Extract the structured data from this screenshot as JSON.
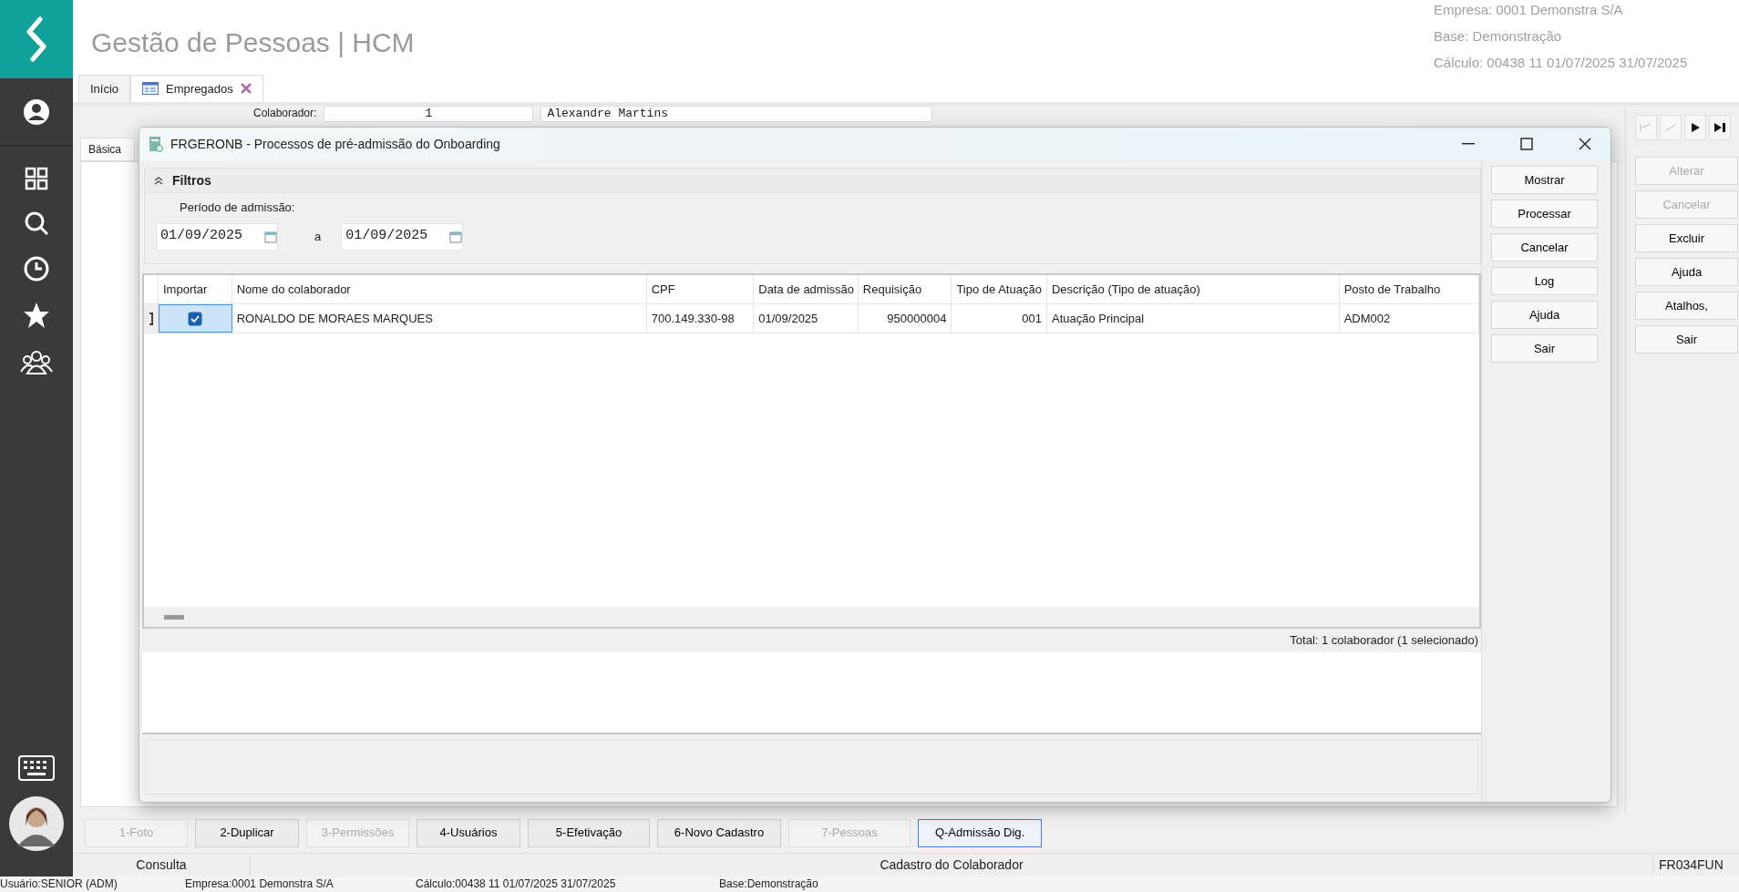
{
  "header": {
    "title": "Gestão de Pessoas | HCM",
    "info": [
      "Empresa: 0001  Demonstra S/A",
      "Base: Demonstração",
      "Cálculo: 00438  11  01/07/2025  31/07/2025"
    ]
  },
  "tabs": [
    {
      "label": "Início",
      "selected": false,
      "closable": false
    },
    {
      "label": "Empregados",
      "selected": true,
      "closable": true
    }
  ],
  "form": {
    "collaborator_label": "Colaborador:",
    "collaborator_code": "1",
    "collaborator_name": "Alexandre Martins",
    "section_tab": "Básica"
  },
  "side_buttons": [
    {
      "label": "Alterar",
      "disabled": true
    },
    {
      "label": "Cancelar",
      "disabled": true
    },
    {
      "label": "Excluir",
      "disabled": false
    },
    {
      "label": "Ajuda",
      "disabled": false
    },
    {
      "label": "Atalhos,",
      "disabled": false
    },
    {
      "label": "Sair",
      "disabled": false
    }
  ],
  "dialog": {
    "title": "FRGERONB - Processos de pré-admissão do Onboarding",
    "filters": {
      "title": "Filtros",
      "expanded": true,
      "period_label": "Período de admissão:",
      "from": "01/09/2025",
      "separator": "a",
      "to": "01/09/2025"
    },
    "table": {
      "check_column": "Importar",
      "columns": [
        "Nome do colaborador",
        "CPF",
        "Data de admissão",
        "Requisição",
        "Tipo de Atuação",
        "Descrição (Tipo de atuação)",
        "Posto de Trabalho"
      ],
      "rows": [
        {
          "checked": true,
          "selected": true,
          "cells": [
            "RONALDO DE MORAES MARQUES",
            "700.149.330-98",
            "01/09/2025",
            "950000004",
            "001",
            "Atuação Principal",
            "ADM002"
          ]
        }
      ]
    },
    "total": "Total: 1 colaborador (1 selecionado)",
    "buttons": [
      "Mostrar",
      "Processar",
      "Cancelar",
      "Log",
      "Ajuda",
      "Sair"
    ]
  },
  "bottom_buttons": [
    {
      "label": "1-Foto",
      "disabled": true,
      "focused": false
    },
    {
      "label": "2-Duplicar",
      "disabled": false,
      "focused": false
    },
    {
      "label": "3-Permissões",
      "disabled": true,
      "focused": false
    },
    {
      "label": "4-Usuários",
      "disabled": false,
      "focused": false
    },
    {
      "label": "5-Efetivação",
      "disabled": false,
      "focused": false
    },
    {
      "label": "6-Novo Cadastro",
      "disabled": false,
      "focused": false
    },
    {
      "label": "7-Pessoas",
      "disabled": true,
      "focused": false
    },
    {
      "label": "Q-Admissão Dig.",
      "disabled": false,
      "focused": true
    }
  ],
  "status_bar": {
    "mode": "Consulta",
    "screen": "Cadastro do Colaborador",
    "code": "FR034FUN"
  },
  "footer": [
    "Usuário:SENIOR (ADM)",
    "Empresa:0001  Demonstra S/A",
    "Cálculo:00438  11  01/07/2025  31/07/2025",
    "Base:Demonstração"
  ]
}
